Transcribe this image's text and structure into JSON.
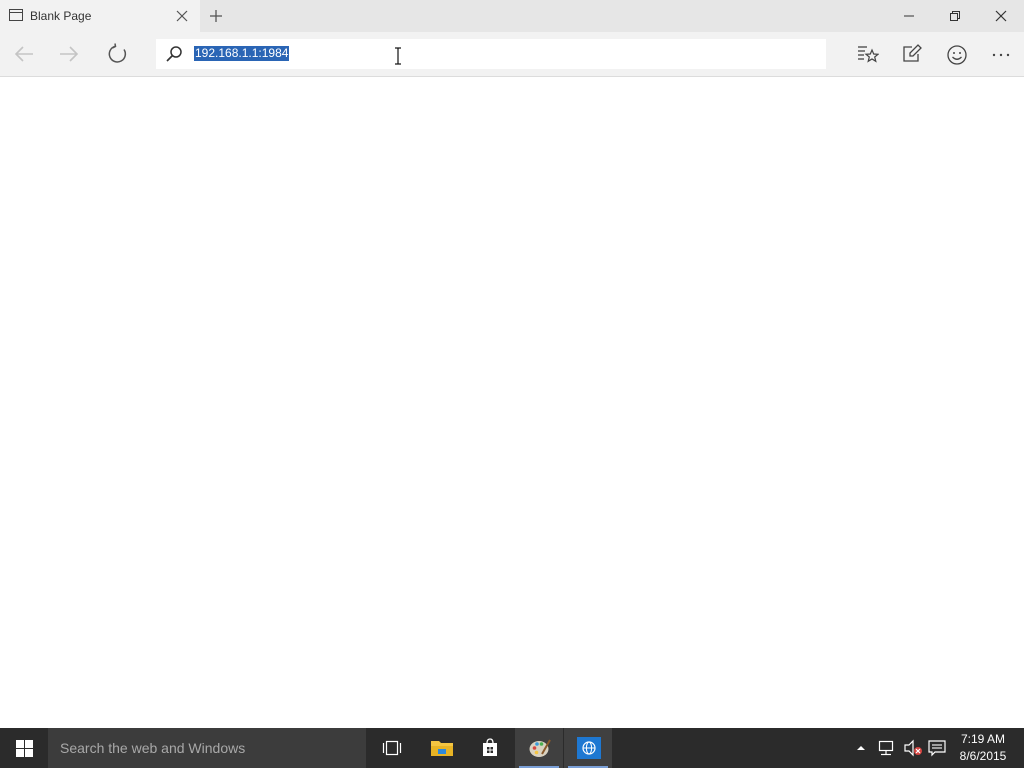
{
  "tab": {
    "title": "Blank Page"
  },
  "address": {
    "url": "192.168.1.1:1984"
  },
  "taskbar": {
    "search_placeholder": "Search the web and Windows",
    "time": "7:19 AM",
    "date": "8/6/2015"
  },
  "icons": {
    "tab": "page-icon",
    "close_tab": "close-icon",
    "new_tab": "plus-icon",
    "minimize": "minimize-icon",
    "restore": "restore-icon",
    "close_window": "close-icon",
    "back": "back-arrow-icon",
    "forward": "forward-arrow-icon",
    "refresh": "refresh-icon",
    "search": "search-icon",
    "reading_view": "favorites-star-icon",
    "web_note": "pen-icon",
    "feedback": "smiley-icon",
    "more": "ellipsis-icon"
  },
  "colors": {
    "selection": "#2a65b5",
    "taskbar": "#2b2b2b",
    "tabbar": "#e6e6e6",
    "toolbar": "#f2f2f2"
  }
}
